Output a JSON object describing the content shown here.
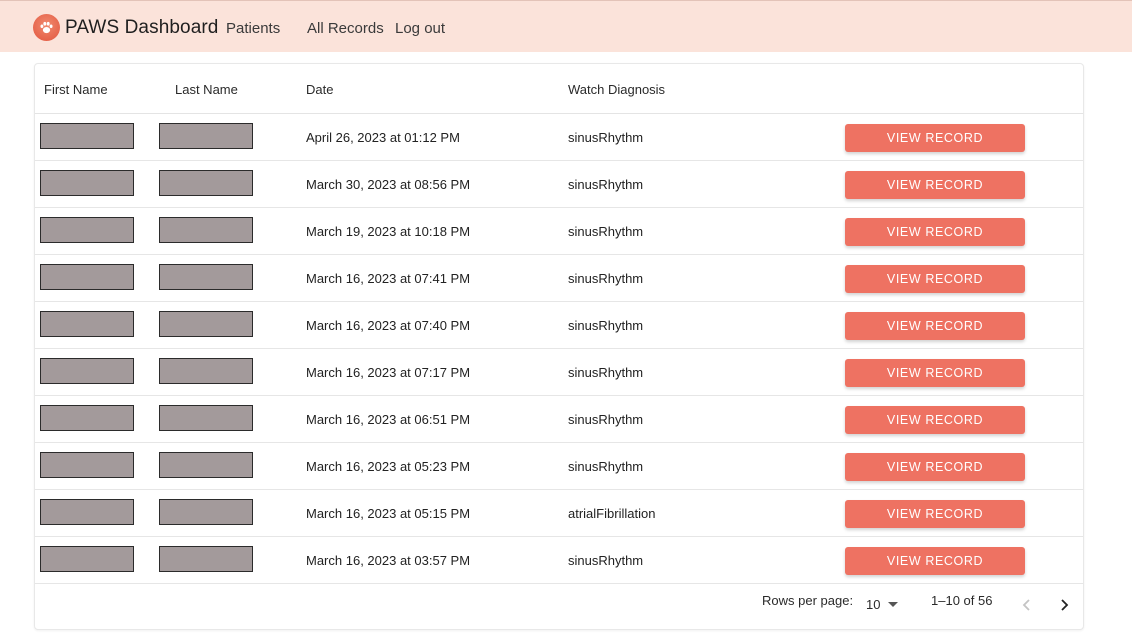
{
  "header": {
    "brand": "PAWS Dashboard",
    "nav": [
      "Patients",
      "All Records",
      "Log out"
    ],
    "logo_icon": "paw-icon",
    "accent": "#e2553e"
  },
  "table": {
    "columns": [
      "First Name",
      "Last Name",
      "Date",
      "Watch Diagnosis"
    ],
    "action_label": "VIEW RECORD",
    "rows": [
      {
        "date": "April 26, 2023 at 01:12 PM",
        "diagnosis": "sinusRhythm"
      },
      {
        "date": "March 30, 2023 at 08:56 PM",
        "diagnosis": "sinusRhythm"
      },
      {
        "date": "March 19, 2023 at 10:18 PM",
        "diagnosis": "sinusRhythm"
      },
      {
        "date": "March 16, 2023 at 07:41 PM",
        "diagnosis": "sinusRhythm"
      },
      {
        "date": "March 16, 2023 at 07:40 PM",
        "diagnosis": "sinusRhythm"
      },
      {
        "date": "March 16, 2023 at 07:17 PM",
        "diagnosis": "sinusRhythm"
      },
      {
        "date": "March 16, 2023 at 06:51 PM",
        "diagnosis": "sinusRhythm"
      },
      {
        "date": "March 16, 2023 at 05:23 PM",
        "diagnosis": "sinusRhythm"
      },
      {
        "date": "March 16, 2023 at 05:15 PM",
        "diagnosis": "atrialFibrillation"
      },
      {
        "date": "March 16, 2023 at 03:57 PM",
        "diagnosis": "sinusRhythm"
      }
    ],
    "button_color": "#ee7262",
    "redaction_color": "#a39a9b"
  },
  "pagination": {
    "rows_per_page_label": "Rows per page:",
    "rows_per_page_value": "10",
    "range": "1–10 of 56"
  }
}
